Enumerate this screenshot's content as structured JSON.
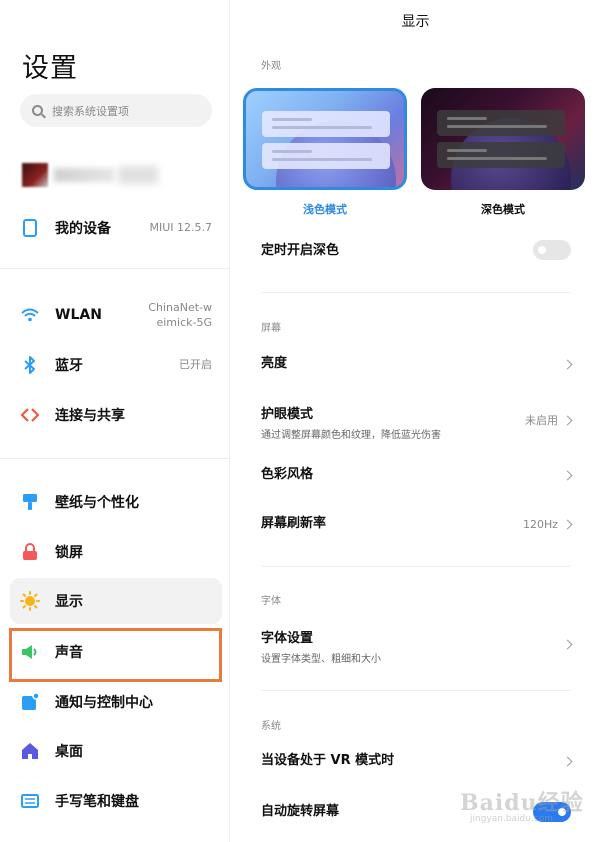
{
  "sidebar": {
    "title": "设置",
    "search_placeholder": "搜索系统设置项",
    "items": [
      {
        "label": "我的设备",
        "value": "MIUI 12.5.7",
        "icon": "phone-icon",
        "color": "#2a9df4"
      },
      {
        "label": "WLAN",
        "value": "ChinaNet-w\neimick-5G",
        "icon": "wifi-icon",
        "color": "#2a9df4"
      },
      {
        "label": "蓝牙",
        "value": "已开启",
        "icon": "bluetooth-icon",
        "color": "#2a9df4"
      },
      {
        "label": "连接与共享",
        "value": "",
        "icon": "share-icon",
        "color": "#f25a3c"
      },
      {
        "label": "壁纸与个性化",
        "value": "",
        "icon": "brush-icon",
        "color": "#2a9df4"
      },
      {
        "label": "锁屏",
        "value": "",
        "icon": "lock-icon",
        "color": "#f25a5a"
      },
      {
        "label": "显示",
        "value": "",
        "icon": "sun-icon",
        "color": "#f5b31c"
      },
      {
        "label": "声音",
        "value": "",
        "icon": "speaker-icon",
        "color": "#3cc46a"
      },
      {
        "label": "通知与控制中心",
        "value": "",
        "icon": "notification-icon",
        "color": "#2a9df4"
      },
      {
        "label": "桌面",
        "value": "",
        "icon": "home-icon",
        "color": "#5a5ae0"
      },
      {
        "label": "手写笔和键盘",
        "value": "",
        "icon": "keyboard-icon",
        "color": "#2a9df4"
      }
    ]
  },
  "main": {
    "title": "显示",
    "sections": {
      "appearance": "外观",
      "screen": "屏幕",
      "font": "字体",
      "system": "系统"
    },
    "themes": {
      "light": "浅色模式",
      "dark": "深色模式"
    },
    "rows": {
      "scheduled_dark": {
        "title": "定时开启深色"
      },
      "brightness": {
        "title": "亮度"
      },
      "eye_care": {
        "title": "护眼模式",
        "sub": "通过调整屏幕颜色和纹理，降低蓝光伤害",
        "value": "未启用"
      },
      "color_style": {
        "title": "色彩风格"
      },
      "refresh_rate": {
        "title": "屏幕刷新率",
        "value": "120Hz"
      },
      "font_settings": {
        "title": "字体设置",
        "sub": "设置字体类型、粗细和大小"
      },
      "vr_mode": {
        "title": "当设备处于 VR 模式时"
      },
      "auto_rotate": {
        "title": "自动旋转屏幕"
      }
    }
  },
  "watermark": {
    "text": "Baidu经验",
    "sub": "jingyan.baidu.com"
  }
}
